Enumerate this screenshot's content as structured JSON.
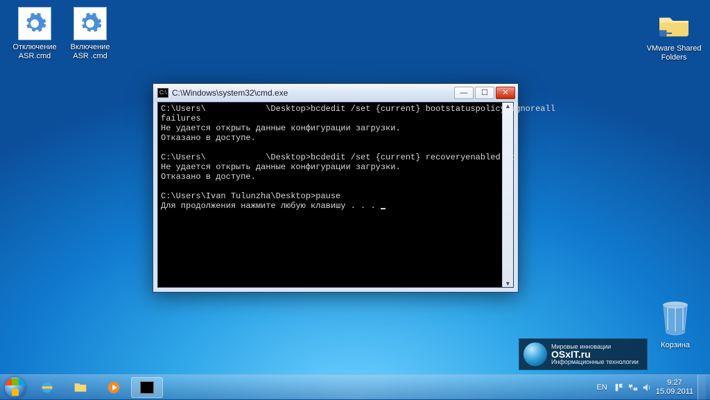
{
  "desktop": {
    "icons": [
      {
        "label": "Отключение ASR.cmd"
      },
      {
        "label": "Включение ASR .cmd"
      },
      {
        "label": "VMware Shared Folders"
      }
    ],
    "recycle_label": "Корзина"
  },
  "cmd": {
    "title": "C:\\Windows\\system32\\cmd.exe",
    "lines": [
      "C:\\Users\\            \\Desktop>bcdedit /set {current} bootstatuspolicy ignoreall",
      "failures",
      "Не удается открыть данные конфигурации загрузки.",
      "Отказано в доступе.",
      "",
      "C:\\Users\\            \\Desktop>bcdedit /set {current} recoveryenabled no",
      "Не удается открыть данные конфигурации загрузки.",
      "Отказано в доступе.",
      "",
      "C:\\Users\\Ivan Tulunzha\\Desktop>pause",
      "Для продолжения нажмите любую клавишу . . . "
    ]
  },
  "taskbar": {
    "lang": "EN",
    "time": "9:27",
    "date": "15.09.2011"
  },
  "badge": {
    "line1": "Мировые инновации",
    "brand": "OSxIT.ru",
    "line2": "Информационные технологии"
  }
}
